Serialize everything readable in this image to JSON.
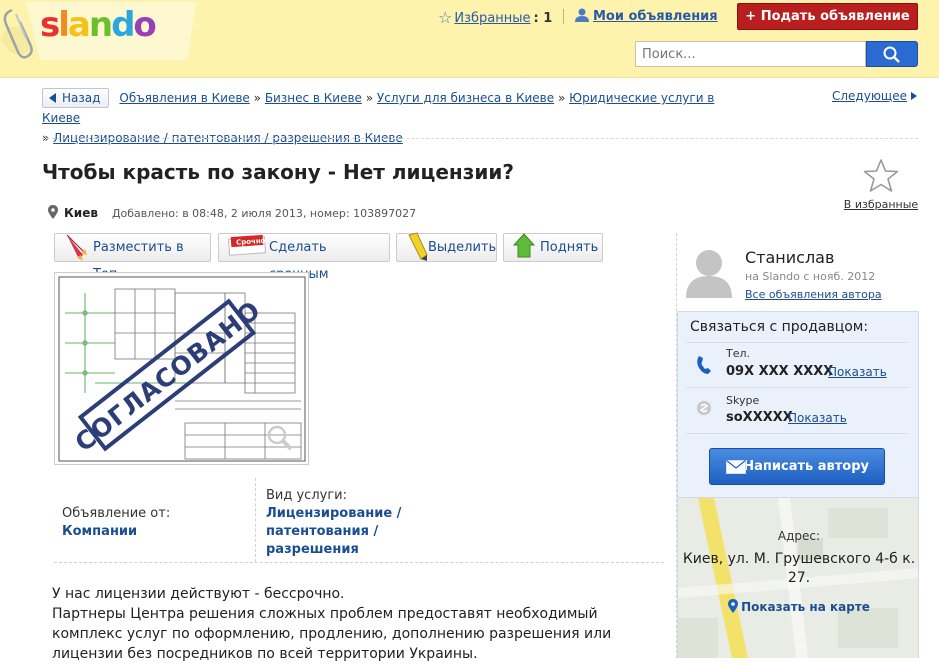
{
  "header": {
    "logo_text": "slando",
    "favorites_label": "Избранные",
    "favorites_count": ": 1",
    "my_ads_label": "Мои объявления",
    "post_button_label": "+ Подать объявление",
    "search_placeholder": "Поиск..."
  },
  "breadcrumbs": {
    "back_label": "Назад",
    "items": [
      "Объявления в Киеве",
      "Бизнес в Киеве",
      "Услуги для бизнеса в Киеве",
      "Юридические услуги в Киеве",
      "Лицензирование / патентования / разрешения в Киеве"
    ],
    "separator": "»",
    "next_label": "Следующее"
  },
  "ad": {
    "title": "Чтобы красть по закону - Нет лицензии?",
    "add_to_favorites_label": "В избранные",
    "city": "Киев",
    "added_info": "Добавлено: в 08:48, 2 июля 2013, номер: 103897027",
    "toolbar": {
      "top_label": "Разместить в Топ",
      "urgent_label": "Сделать срочным",
      "urgent_badge": "Срочно",
      "highlight_label": "Выделить",
      "raise_label": "Поднять"
    },
    "photo_stamp": "СОГЛАСОВАНО",
    "details": {
      "seller_type_label": "Объявление от:",
      "seller_type_value": "Компании",
      "service_type_label": "Вид услуги:",
      "service_type_value": "Лицензирование / патентования / разрешения"
    },
    "description_lines": [
      "У нас лицензии действуют - бессрочно.",
      "Партнеры Центра решения сложных проблем предоставят необходимый комплекс услуг по оформлению, продлению, дополнению разрешения или лицензии без посредников по всей территории Украины."
    ]
  },
  "seller": {
    "name": "Станислав",
    "since": "на Slando с нояб. 2012",
    "all_ads_label": "Все объявления автора",
    "contact_title": "Связаться с продавцом:",
    "phone_label": "Тел.",
    "phone_value": "09X XXX XXXX",
    "phone_show": "Показать",
    "skype_label": "Skype",
    "skype_value": "soXXXXX",
    "skype_show": "Показать",
    "write_button_label": "Написать автору",
    "address_label": "Адрес:",
    "address_value": "Киев, ул. М. Грушевского 4-б к. 27.",
    "show_on_map_label": "Показать на карте"
  },
  "colors": {
    "header_bg": "#fdf3ad",
    "link": "#1a4d91",
    "post_button": "#ba1f1f",
    "search_button": "#2a6bd1",
    "contact_bg": "#eaf1fa"
  }
}
